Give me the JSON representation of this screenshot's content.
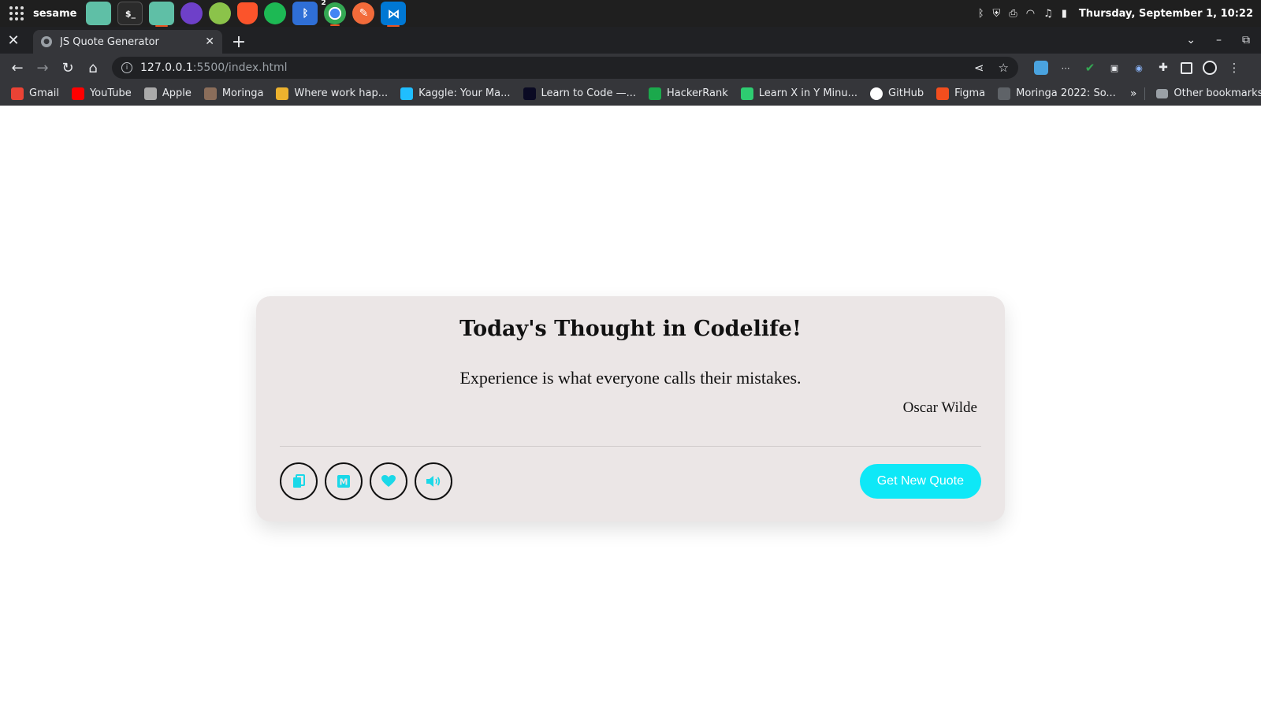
{
  "os": {
    "user": "sesame",
    "clock": "Thursday, September  1, 10:22",
    "dock_icons": [
      "files-icon",
      "terminal-icon",
      "folder-icon",
      "github-desktop-icon",
      "globe-app-icon",
      "brave-icon",
      "spotify-icon",
      "bluetooth-icon",
      "chrome-icon",
      "pencil-app-icon",
      "vscode-icon"
    ],
    "chrome_badge": "2",
    "tray_icons": [
      "bluetooth-icon",
      "shield-icon",
      "printer-icon",
      "wifi-icon",
      "music-icon",
      "battery-icon"
    ]
  },
  "browser": {
    "tab_title": "JS Quote Generator",
    "url_host": "127.0.0.1",
    "url_rest": ":5500/index.html",
    "bookmarks": [
      {
        "label": "Gmail",
        "icon": "gmail-icon",
        "color": "#ea4335"
      },
      {
        "label": "YouTube",
        "icon": "youtube-icon",
        "color": "#ff0000"
      },
      {
        "label": "Apple",
        "icon": "apple-icon",
        "color": "#aaaaaa"
      },
      {
        "label": "Moringa",
        "icon": "moringa-icon",
        "color": "#8a6d5a"
      },
      {
        "label": "Where work hap...",
        "icon": "slack-icon",
        "color": "#ecb22e"
      },
      {
        "label": "Kaggle: Your Ma...",
        "icon": "kaggle-icon",
        "color": "#20beff"
      },
      {
        "label": "Learn to Code —...",
        "icon": "freecodecamp-icon",
        "color": "#0a0a23"
      },
      {
        "label": "HackerRank",
        "icon": "hackerrank-icon",
        "color": "#1ba94c"
      },
      {
        "label": "Learn X in Y Minu...",
        "icon": "learnx-icon",
        "color": "#2ecc71"
      },
      {
        "label": "GitHub",
        "icon": "github-icon",
        "color": "#ffffff"
      },
      {
        "label": "Figma",
        "icon": "figma-icon",
        "color": "#f24e1e"
      },
      {
        "label": "Moringa 2022: So...",
        "icon": "moringa-lightning-icon",
        "color": "#5f6368"
      }
    ],
    "other_bookmarks": "Other bookmarks"
  },
  "card": {
    "title": "Today's Thought in Codelife!",
    "quote": "Experience is what everyone calls their mistakes.",
    "author": "Oscar Wilde",
    "new_quote_label": "Get New Quote",
    "accent": "#0ee8f7",
    "actions": [
      "copy-icon",
      "medium-icon",
      "heart-icon",
      "speaker-icon"
    ]
  }
}
